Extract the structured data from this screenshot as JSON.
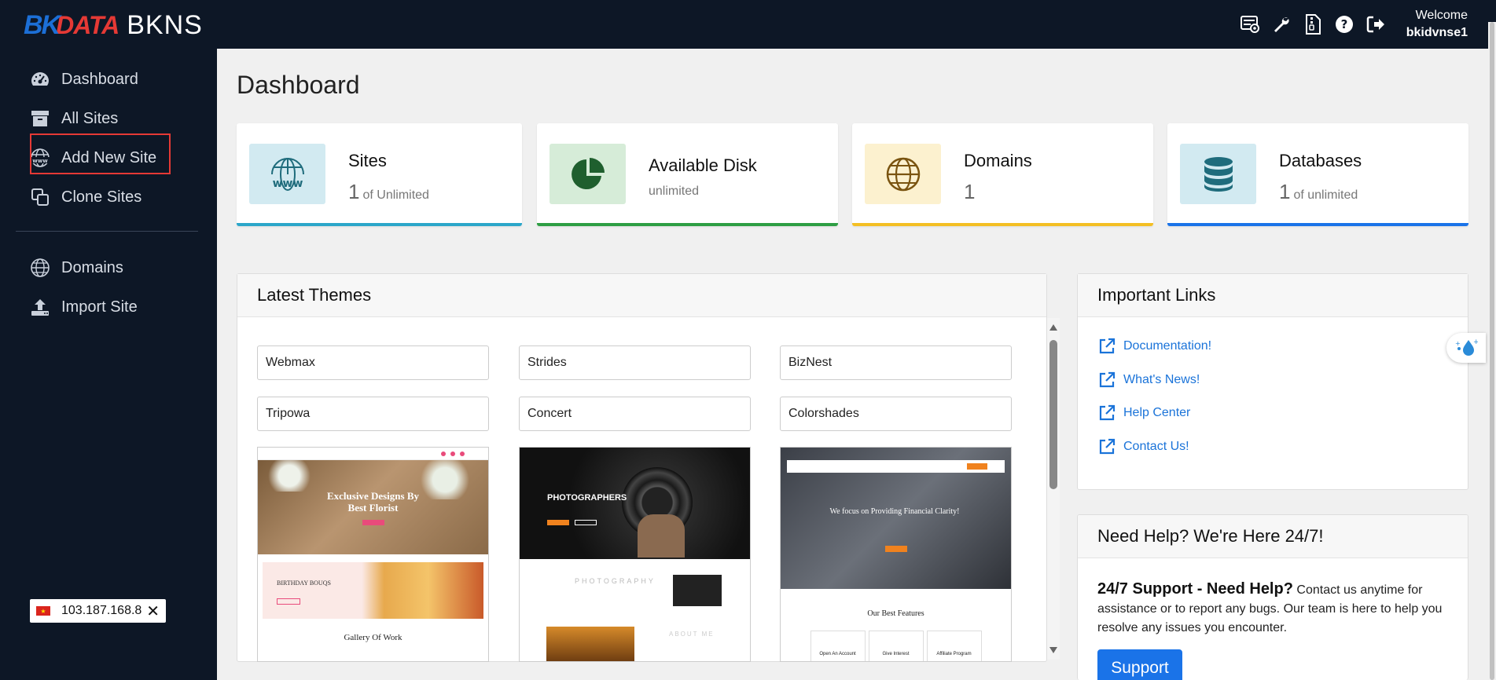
{
  "brand": {
    "part1": "BK",
    "part2": "DATA",
    "part3": "BKNS"
  },
  "header": {
    "welcome": "Welcome",
    "username": "bkidvnse1",
    "icons": [
      "server-gear-icon",
      "wrench-icon",
      "file-zip-icon",
      "help-icon",
      "logout-icon"
    ]
  },
  "sidebar": {
    "items": [
      {
        "label": "Dashboard",
        "icon": "dashboard-icon"
      },
      {
        "label": "All Sites",
        "icon": "archive-icon"
      },
      {
        "label": "Add New Site",
        "icon": "www-icon"
      },
      {
        "label": "Clone Sites",
        "icon": "clone-icon"
      },
      {
        "label": "Domains",
        "icon": "globe-icon"
      },
      {
        "label": "Import Site",
        "icon": "upload-icon"
      }
    ]
  },
  "ip_badge": {
    "ip": "103.187.168.8"
  },
  "page": {
    "title": "Dashboard"
  },
  "stats": [
    {
      "label": "Sites",
      "num": "1",
      "suffix": "of Unlimited",
      "color": "#d2eaf1",
      "bar": "#2ba6c9"
    },
    {
      "label": "Available Disk",
      "num": "",
      "suffix": "unlimited",
      "color": "#d6ecd8",
      "bar": "#2e9e44"
    },
    {
      "label": "Domains",
      "num": "1",
      "suffix": "",
      "color": "#fcf1cf",
      "bar": "#f4bf24"
    },
    {
      "label": "Databases",
      "num": "1",
      "suffix": "of unlimited",
      "color": "#d2eaf1",
      "bar": "#1a73e8"
    }
  ],
  "latest_themes": {
    "title": "Latest Themes",
    "names": [
      "Webmax",
      "Strides",
      "BizNest",
      "Tripowa",
      "Concert",
      "Colorshades"
    ],
    "thumb1": {
      "hero": "Exclusive Designs By Best Florist",
      "section": "BIRTHDAY BOUQS",
      "gallery": "Gallery Of Work"
    },
    "thumb2": {
      "hero": "PHOTOGRAPHERS",
      "section": "PHOTOGRAPHY",
      "about": "ABOUT ME"
    },
    "thumb3": {
      "hero": "We focus on Providing Financial Clarity!",
      "features": "Our Best Features",
      "f1": "Open An Account",
      "f2": "Give Interest",
      "f3": "Affiliate Program"
    }
  },
  "important_links": {
    "title": "Important Links",
    "items": [
      "Documentation!",
      "What's News!",
      "Help Center",
      "Contact Us!"
    ]
  },
  "help": {
    "title": "Need Help? We're Here 24/7!",
    "lead": "24/7 Support - Need Help?",
    "body": "Contact us anytime for assistance or to report any bugs. Our team is here to help you resolve any issues you encounter.",
    "button": "Support"
  }
}
